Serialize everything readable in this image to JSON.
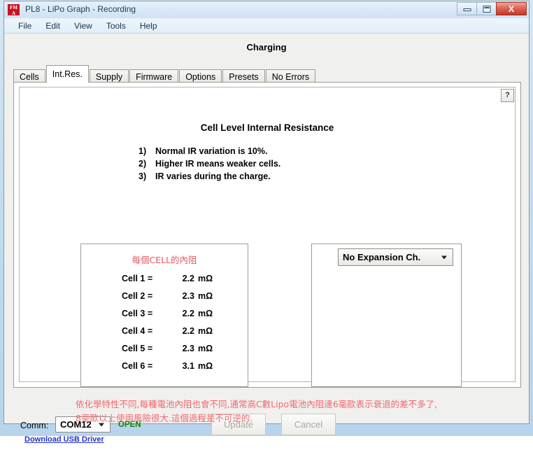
{
  "window": {
    "title": "PL8 - LiPo Graph - Recording",
    "logo_top": "FM",
    "logo_bottom": "A",
    "minimize_label": "Minimize",
    "maximize_label": "Maximize",
    "close_label": "X"
  },
  "menubar": {
    "items": [
      {
        "label": "File"
      },
      {
        "label": "Edit"
      },
      {
        "label": "View"
      },
      {
        "label": "Tools"
      },
      {
        "label": "Help"
      }
    ]
  },
  "status": {
    "heading": "Charging"
  },
  "tabs": [
    {
      "label": "Cells",
      "active": false
    },
    {
      "label": "Int.Res.",
      "active": true
    },
    {
      "label": "Supply",
      "active": false
    },
    {
      "label": "Firmware",
      "active": false
    },
    {
      "label": "Options",
      "active": false
    },
    {
      "label": "Presets",
      "active": false
    },
    {
      "label": "No Errors",
      "active": false
    }
  ],
  "panel": {
    "title": "Cell Level Internal Resistance",
    "help_label": "?",
    "bullets": [
      {
        "num": "1)",
        "text": "Normal IR variation is 10%."
      },
      {
        "num": "2)",
        "text": "Higher IR means weaker cells."
      },
      {
        "num": "3)",
        "text": "IR varies during the charge."
      }
    ]
  },
  "cells_panel": {
    "heading": "每個CELL的內阻",
    "rows": [
      {
        "label": "Cell 1 =",
        "value": "2.2",
        "unit": "mΩ"
      },
      {
        "label": "Cell 2 =",
        "value": "2.3",
        "unit": "mΩ"
      },
      {
        "label": "Cell 3 =",
        "value": "2.2",
        "unit": "mΩ"
      },
      {
        "label": "Cell 4 =",
        "value": "2.2",
        "unit": "mΩ"
      },
      {
        "label": "Cell 5 =",
        "value": "2.3",
        "unit": "mΩ"
      },
      {
        "label": "Cell 6 =",
        "value": "3.1",
        "unit": "mΩ"
      }
    ]
  },
  "expansion_panel": {
    "selected": "No Expansion Ch."
  },
  "note": {
    "line1": "依化學特性不同,每種電池內阻也會不同,通常高C數Lipo電池內阻達6毫歐表示衰退的差不多了,",
    "line2": "8毫歐以上使用風險很大.這個過程是不可逆的."
  },
  "bottom": {
    "comm_label": "Comm:",
    "comm_value": "COM12",
    "open_status": "OPEN",
    "usb_link": "Download USB Driver",
    "update_label": "Update",
    "cancel_label": "Cancel"
  },
  "colors": {
    "accent_red": "#e8575f",
    "note_red": "#f2686e",
    "open_green": "#108010",
    "link_blue": "#2233cc",
    "logo_red": "#cc1122"
  }
}
